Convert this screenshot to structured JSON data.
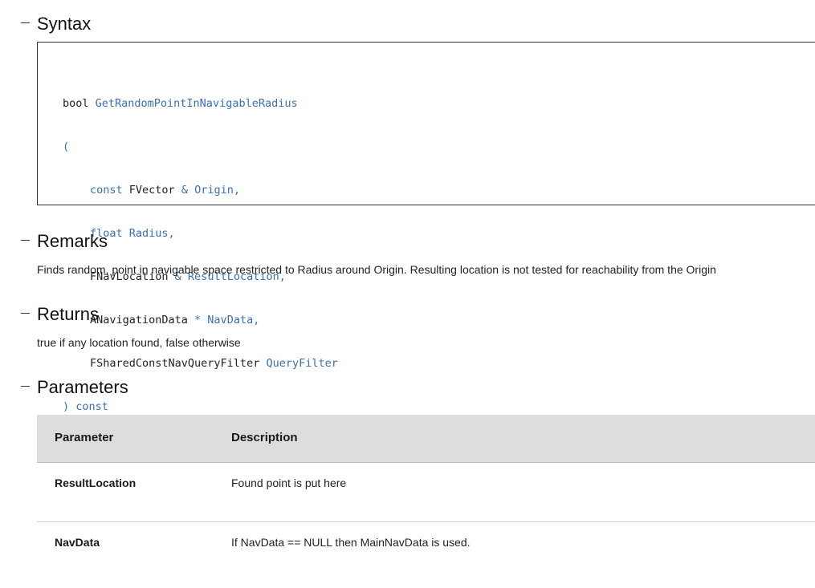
{
  "sections": {
    "syntax": {
      "title": "Syntax"
    },
    "remarks": {
      "title": "Remarks",
      "text": "Finds random, point in navigable space restricted to Radius around Origin. Resulting location is not tested for reachability from the Origin"
    },
    "returns": {
      "title": "Returns",
      "text": "true if any location found, false otherwise"
    },
    "parameters": {
      "title": "Parameters"
    }
  },
  "code": {
    "return_type": "bool ",
    "function_name": "GetRandomPointInNavigableRadius",
    "open_paren": "(",
    "params": [
      {
        "type": "",
        "blue": "const FVector",
        "rest_blue": "",
        "type_dark": "",
        "sep": ""
      },
      {
        "type": "",
        "blue": "",
        "rest_blue": "",
        "type_dark": "",
        "sep": ""
      }
    ],
    "line1_const": "const ",
    "line1_type": "FVector",
    "line1_rest": " & Origin,",
    "line2": "float Radius,",
    "line3_type": "FNavLocation",
    "line3_rest": " & ResultLocation,",
    "line4_type": "ANavigationData",
    "line4_rest": " * NavData,",
    "line5_type": "FSharedConstNavQueryFilter",
    "line5_rest": " QueryFilter",
    "close_paren": ")",
    "close_const": " const"
  },
  "table": {
    "headers": {
      "parameter": "Parameter",
      "description": "Description"
    },
    "rows": [
      {
        "name": "ResultLocation",
        "description": "Found point is put here"
      },
      {
        "name": "NavData",
        "description": "If NavData == NULL then MainNavData is used."
      }
    ]
  },
  "colors": {
    "code_blue": "#3a6fb8",
    "header_bg": "#dddddd"
  }
}
